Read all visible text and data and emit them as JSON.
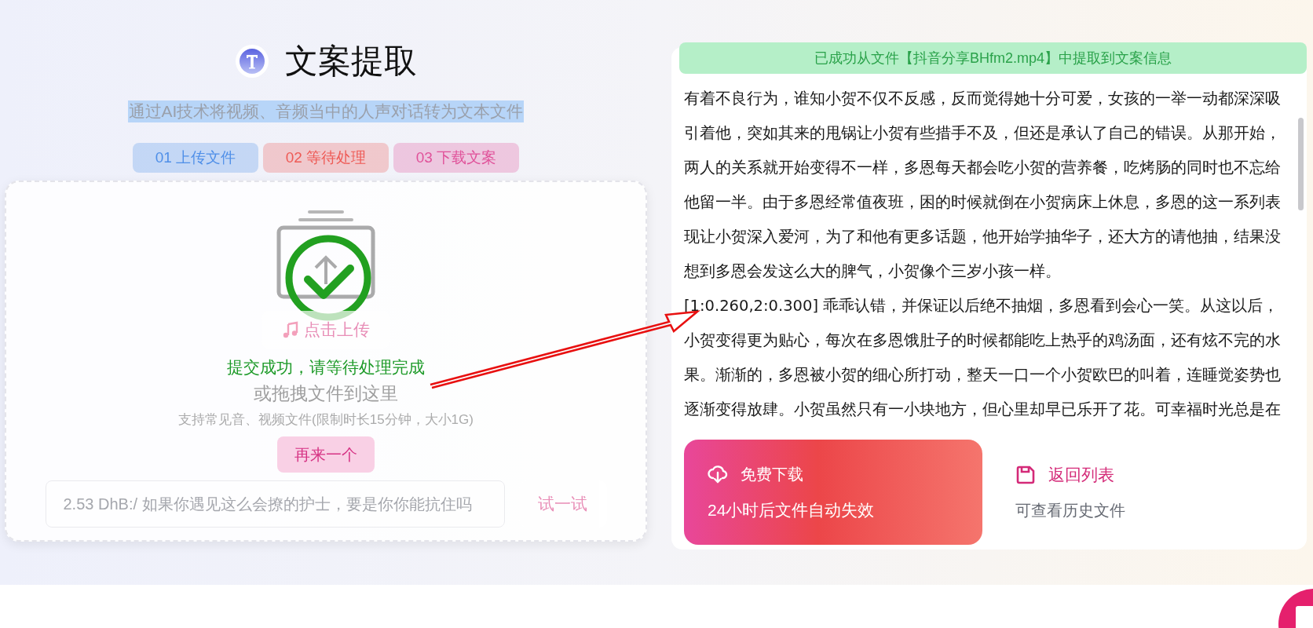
{
  "header": {
    "title": "文案提取",
    "subtitle": "通过AI技术将视频、音频当中的人声对话转为文本文件"
  },
  "steps": [
    {
      "label": "01 上传文件",
      "color": "#4f8fe8"
    },
    {
      "label": "02 等待处理",
      "color": "#ee5a55"
    },
    {
      "label": "03 下载文案",
      "color": "#e0529a"
    }
  ],
  "upload_card": {
    "upload_button": "点击上传",
    "success_message": "提交成功，请等待处理完成",
    "drag_hint": "或拖拽文件到这里",
    "support_hint": "支持常见音、视频文件(限制时长15分钟，大小1G)",
    "retry_button": "再来一个",
    "link_input": {
      "placeholder": "2.53 DhB:/ 如果你遇见这么会撩的护士，要是你你能抗住吗"
    },
    "try_button": "试一试"
  },
  "result": {
    "notice": "已成功从文件【抖音分享BHfm2.mp4】中提取到文案信息",
    "paragraphs": [
      "有着不良行为，谁知小贺不仅不反感，反而觉得她十分可爱，女孩的一举一动都深深吸引着他，突如其来的甩锅让小贺有些措手不及，但还是承认了自己的错误。从那开始，两人的关系就开始变得不一样，多恩每天都会吃小贺的营养餐，吃烤肠的同时也不忘给他留一半。由于多恩经常值夜班，困的时候就倒在小贺病床上休息，多恩的这一系列表现让小贺深入爱河，为了和他有更多话题，他开始学抽华子，还大方的请他抽，结果没想到多恩会发这么大的脾气，小贺像个三岁小孩一样。",
      "[1:0.260,2:0.300] 乖乖认错，并保证以后绝不抽烟，多恩看到会心一笑。从这以后，小贺变得更为贴心，每次在多恩饿肚子的时候都能吃上热乎的鸡汤面，还有炫不完的水果。渐渐的，多恩被小贺的细心所打动，整天一口一个小贺欧巴的叫着，连睡觉姿势也逐渐变得放肆。小贺虽然只有一小块地方，但心里却早已乐开了花。可幸福时光总是在"
    ],
    "download": {
      "title": "免费下载",
      "note": "24小时后文件自动失效"
    },
    "back": {
      "title": "返回列表",
      "note": "可查看历史文件"
    }
  }
}
